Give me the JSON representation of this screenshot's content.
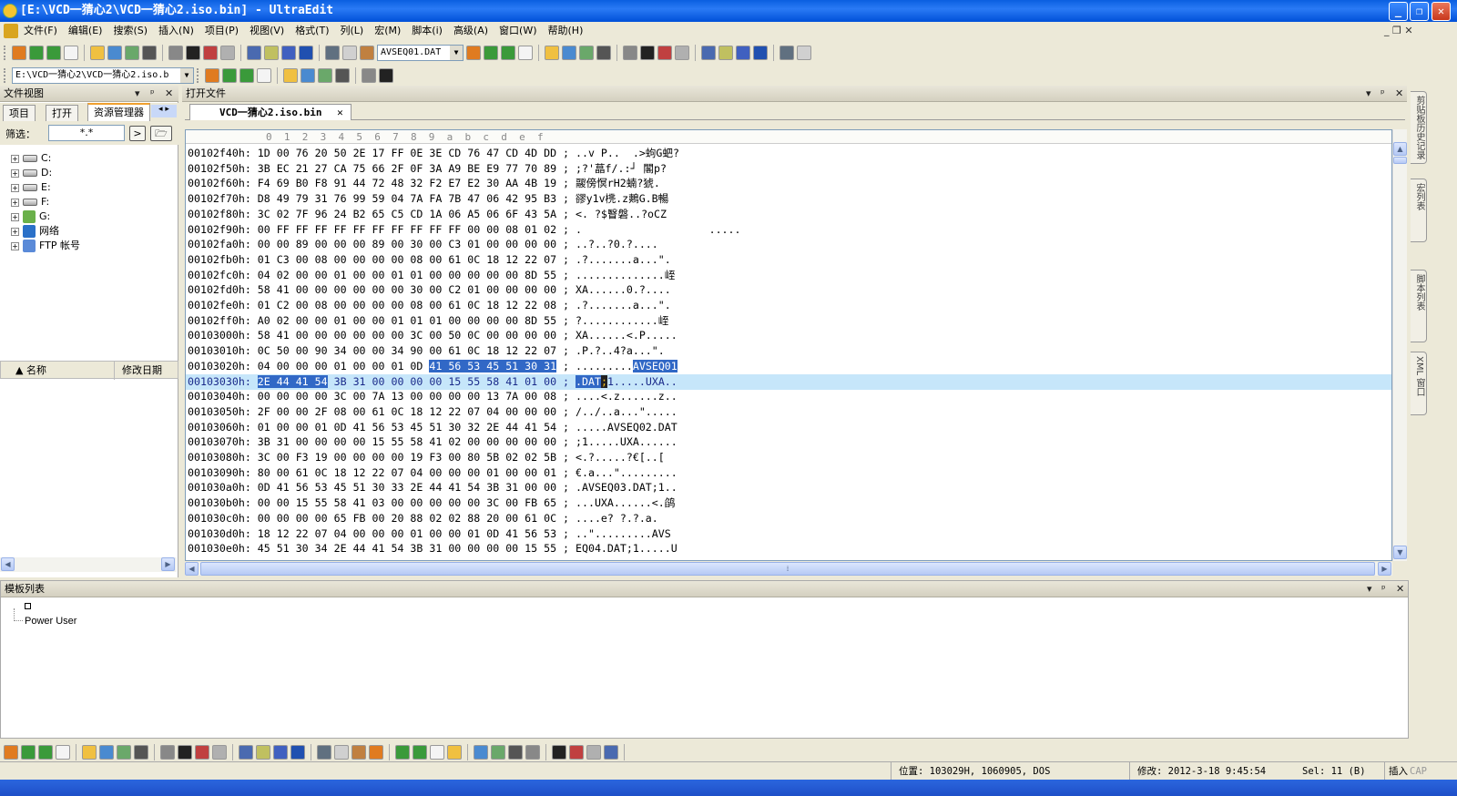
{
  "window": {
    "title": "[E:\\VCD一猜心2\\VCD一猜心2.iso.bin] - UltraEdit",
    "min": "_",
    "restore": "❐",
    "close": "✕"
  },
  "menu": [
    "文件(F)",
    "编辑(E)",
    "搜索(S)",
    "插入(N)",
    "项目(P)",
    "视图(V)",
    "格式(T)",
    "列(L)",
    "宏(M)",
    "脚本(i)",
    "高级(A)",
    "窗口(W)",
    "帮助(H)"
  ],
  "mdi_controls": "_  ❐  ✕",
  "toolbar1": {
    "icons": [
      "new-from-template",
      "back",
      "forward",
      "new-file",
      "open-file",
      "open-folder",
      "save",
      "print",
      "print-preview",
      "font",
      "word-wrap",
      "column-mode",
      "hex-mode",
      "ruler",
      "line-numbers",
      "ftp",
      "cut",
      "copy",
      "paste"
    ],
    "combo": "AVSEQ01.DAT",
    "icons2": [
      "find-binoculars",
      "find-prev",
      "find-next",
      "replace",
      "bookmark",
      "spell",
      "align-left",
      "align-center",
      "align-right",
      "justify",
      "window-split",
      "tile",
      "cascade",
      "browser",
      "preview",
      "refresh",
      "tip",
      "help"
    ]
  },
  "toolbar2": {
    "path": "E:\\VCD一猜心2\\VCD一猜心2.iso.b",
    "icons": [
      "google",
      "yahoo",
      "wikipedia",
      "web",
      "lightbulb",
      "dictionary",
      "ms",
      "php",
      "fx",
      "windows"
    ]
  },
  "left_panel": {
    "title": "文件视图",
    "tabs": [
      "项目",
      "打开",
      "资源管理器"
    ],
    "filter_label": "筛选：",
    "filter_value": "*.*",
    "go": ">",
    "tree": [
      {
        "label": "C:",
        "icon": "drive"
      },
      {
        "label": "D:",
        "icon": "drive"
      },
      {
        "label": "E:",
        "icon": "drive"
      },
      {
        "label": "F:",
        "icon": "drive"
      },
      {
        "label": "G:",
        "icon": "cd-drive"
      },
      {
        "label": "网络",
        "icon": "network"
      },
      {
        "label": "FTP 帐号",
        "icon": "ftp"
      }
    ],
    "col_name": "▲  名称",
    "col_date": "修改日期"
  },
  "editor": {
    "title": "打开文件",
    "tab": "VCD一猜心2.iso.bin",
    "ruler": "0  1  2  3  4  5  6  7  8  9  a  b  c  d  e  f",
    "rows": [
      {
        "o": "00102f40h:",
        "b": "1D 00 76 20 50 2E 17 FF 0E 3E CD 76 47 CD 4D DD",
        "a": "..v P..  .>蚼G蚆?"
      },
      {
        "o": "00102f50h:",
        "b": "3B EC 21 27 CA 75 66 2F 0F 3A A9 BE E9 77 70 89",
        "a": ";?'蕌f/.:┘ 閣p?"
      },
      {
        "o": "00102f60h:",
        "b": "F4 69 B0 F8 91 44 72 48 32 F2 E7 E2 30 AA 4B 19",
        "a": "鬷傍慏rH2蝻?猇."
      },
      {
        "o": "00102f70h:",
        "b": "D8 49 79 31 76 99 59 04 7A FA 7B 47 06 42 95 B3",
        "a": "豂y1v橷.z鷞G.B暢"
      },
      {
        "o": "00102f80h:",
        "b": "3C 02 7F 96 24 B2 65 C5 CD 1A 06 A5 06 6F 43 5A",
        "a": "<. ?$瞖磐..?oCZ"
      },
      {
        "o": "00102f90h:",
        "b": "00 FF FF FF FF FF FF FF FF FF FF 00 00 08 01 02",
        "a": ".                    ....."
      },
      {
        "o": "00102fa0h:",
        "b": "00 00 89 00 00 00 89 00 30 00 C3 01 00 00 00 00",
        "a": "..?..?0.?...."
      },
      {
        "o": "00102fb0h:",
        "b": "01 C3 00 08 00 00 00 00 08 00 61 0C 18 12 22 07",
        "a": ".?.......a...\"."
      },
      {
        "o": "00102fc0h:",
        "b": "04 02 00 00 01 00 00 01 01 00 00 00 00 00 8D 55",
        "a": "..............峌"
      },
      {
        "o": "00102fd0h:",
        "b": "58 41 00 00 00 00 00 00 30 00 C2 01 00 00 00 00",
        "a": "XA......0.?...."
      },
      {
        "o": "00102fe0h:",
        "b": "01 C2 00 08 00 00 00 00 08 00 61 0C 18 12 22 08",
        "a": ".?.......a...\"."
      },
      {
        "o": "00102ff0h:",
        "b": "A0 02 00 00 01 00 00 01 01 01 00 00 00 00 8D 55",
        "a": "?............峌"
      },
      {
        "o": "00103000h:",
        "b": "58 41 00 00 00 00 00 00 3C 00 50 0C 00 00 00 00",
        "a": "XA......<.P....."
      },
      {
        "o": "00103010h:",
        "b": "0C 50 00 90 34 00 00 34 90 00 61 0C 18 12 22 07",
        "a": ".P.?..4?a...\"."
      },
      {
        "o": "00103020h:",
        "b": "04 00 00 00 01 00 00 01 0D 41 56 53 45 51 30 31",
        "a": ".........AVSEQ01",
        "sb": [
          9,
          15
        ],
        "sa": [
          9,
          15
        ]
      },
      {
        "o": "00103030h:",
        "b": "2E 44 41 54 3B 31 00 00 00 00 15 55 58 41 01 00",
        "a": ".DAT;1.....UXA..",
        "sb": [
          0,
          3
        ],
        "sa": [
          0,
          3
        ],
        "caret": 4,
        "current": true
      },
      {
        "o": "00103040h:",
        "b": "00 00 00 00 3C 00 7A 13 00 00 00 00 13 7A 00 08",
        "a": "....<.z......z.."
      },
      {
        "o": "00103050h:",
        "b": "2F 00 00 2F 08 00 61 0C 18 12 22 07 04 00 00 00",
        "a": "/../..a...\"....."
      },
      {
        "o": "00103060h:",
        "b": "01 00 00 01 0D 41 56 53 45 51 30 32 2E 44 41 54",
        "a": ".....AVSEQ02.DAT"
      },
      {
        "o": "00103070h:",
        "b": "3B 31 00 00 00 00 15 55 58 41 02 00 00 00 00 00",
        "a": ";1.....UXA......"
      },
      {
        "o": "00103080h:",
        "b": "3C 00 F3 19 00 00 00 00 19 F3 00 80 5B 02 02 5B",
        "a": "<.?.....?€[..["
      },
      {
        "o": "00103090h:",
        "b": "80 00 61 0C 18 12 22 07 04 00 00 00 01 00 00 01",
        "a": "€.a...\"........."
      },
      {
        "o": "001030a0h:",
        "b": "0D 41 56 53 45 51 30 33 2E 44 41 54 3B 31 00 00",
        "a": ".AVSEQ03.DAT;1.."
      },
      {
        "o": "001030b0h:",
        "b": "00 00 15 55 58 41 03 00 00 00 00 00 3C 00 FB 65",
        "a": "...UXA......<.鹐"
      },
      {
        "o": "001030c0h:",
        "b": "00 00 00 00 65 FB 00 20 88 02 02 88 20 00 61 0C",
        "a": "....e? ?.?.a."
      },
      {
        "o": "001030d0h:",
        "b": "18 12 22 07 04 00 00 00 01 00 00 01 0D 41 56 53",
        "a": "..\".........AVS"
      },
      {
        "o": "001030e0h:",
        "b": "45 51 30 34 2E 44 41 54 3B 31 00 00 00 00 15 55",
        "a": "EQ04.DAT;1.....U"
      }
    ]
  },
  "right_tabs": [
    "剪贴板历史记录",
    "宏列表",
    "脚本列表",
    "XML 窗口"
  ],
  "template_panel": {
    "title": "模板列表",
    "item": "Power User"
  },
  "bottom_toolbar": {
    "icons": [
      "html-tag",
      "bold",
      "italic",
      "underline",
      "h1",
      "h2",
      "h3",
      "para",
      "color",
      "align",
      "list1",
      "list2",
      "list3",
      "form",
      "input",
      "button",
      "textarea",
      "select",
      "checkbox",
      "radio",
      "image",
      "table",
      "anchor",
      "comment",
      "frame",
      "div",
      "email",
      "ie-preview",
      "copy-page",
      "css",
      "link",
      "edit"
    ]
  },
  "status": {
    "position": "位置: 103029H, 1060905, DOS",
    "modified": "修改:  2012-3-18 9:45:54",
    "sel": "Sel: 11 (B)",
    "insert": "插入",
    "cap": "CAP"
  },
  "colors": {
    "selection": "#3168c6",
    "current_line": "#c6e6fa",
    "titlebar": "#0a5fe0"
  }
}
